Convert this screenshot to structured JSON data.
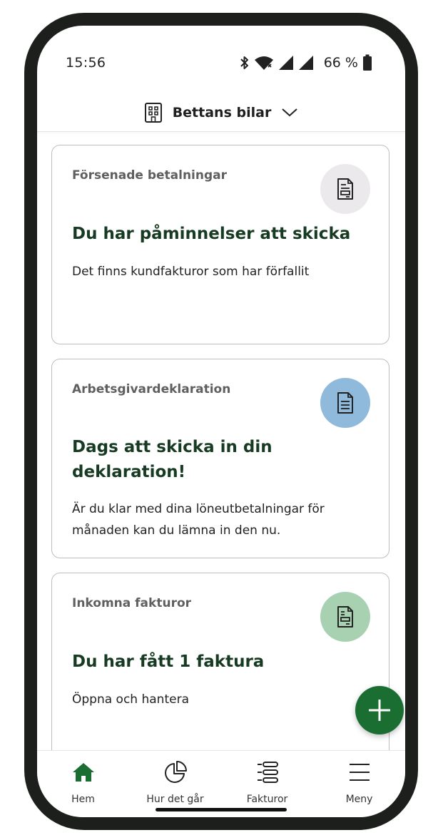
{
  "status_bar": {
    "time": "15:56",
    "battery": "66 %",
    "icons": [
      "bluetooth-icon",
      "wifi-icon",
      "signal-icon",
      "signal-icon",
      "battery-icon"
    ]
  },
  "header": {
    "company_name": "Bettans bilar",
    "icon": "building-icon",
    "dropdown_icon": "chevron-down-icon"
  },
  "cards": [
    {
      "category": "Försenade betalningar",
      "title": "Du har påminnelser att skicka",
      "description": "Det finns kundfakturor som har förfallit",
      "icon": "invoice-icon",
      "icon_bg": "#ece9ec"
    },
    {
      "category": "Arbetsgivardeklaration",
      "title": "Dags att skicka in din deklaration!",
      "description": "Är du klar med dina löneutbetalningar för månaden kan du lämna in den nu.",
      "icon": "document-icon",
      "icon_bg": "#8fbadc"
    },
    {
      "category": "Inkomna fakturor",
      "title": "Du har fått 1 faktura",
      "description": "Öppna och hantera",
      "icon": "received-invoice-icon",
      "icon_bg": "#a8d1b2"
    }
  ],
  "fab": {
    "icon": "plus-icon",
    "color": "#1b6e32"
  },
  "bottom_nav": [
    {
      "label": "Hem",
      "icon": "home-icon",
      "active": true
    },
    {
      "label": "Hur det går",
      "icon": "pie-chart-icon",
      "active": false
    },
    {
      "label": "Fakturor",
      "icon": "list-icon",
      "active": false
    },
    {
      "label": "Meny",
      "icon": "menu-icon",
      "active": false
    }
  ],
  "colors": {
    "accent": "#1b6e32",
    "title_text": "#173a22"
  }
}
